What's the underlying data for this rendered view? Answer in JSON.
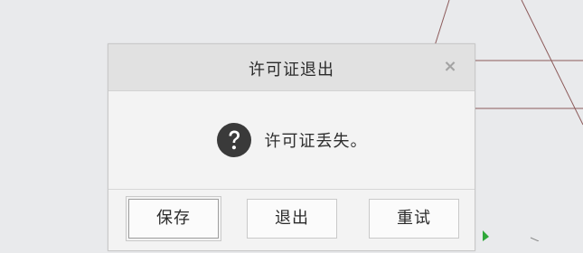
{
  "dialog": {
    "title": "许可证退出",
    "close_symbol": "×",
    "message": "许可证丢失。",
    "icon": "question-icon"
  },
  "buttons": {
    "save": "保存",
    "exit": "退出",
    "retry": "重试"
  },
  "colors": {
    "background": "#e9eaec",
    "titlebar": "#e1e1e1",
    "dialog_body": "#f3f3f3",
    "icon_fill": "#3a3a3a",
    "canvas_lines": "#8c5a5a",
    "cursor_green": "#2fa83a"
  }
}
